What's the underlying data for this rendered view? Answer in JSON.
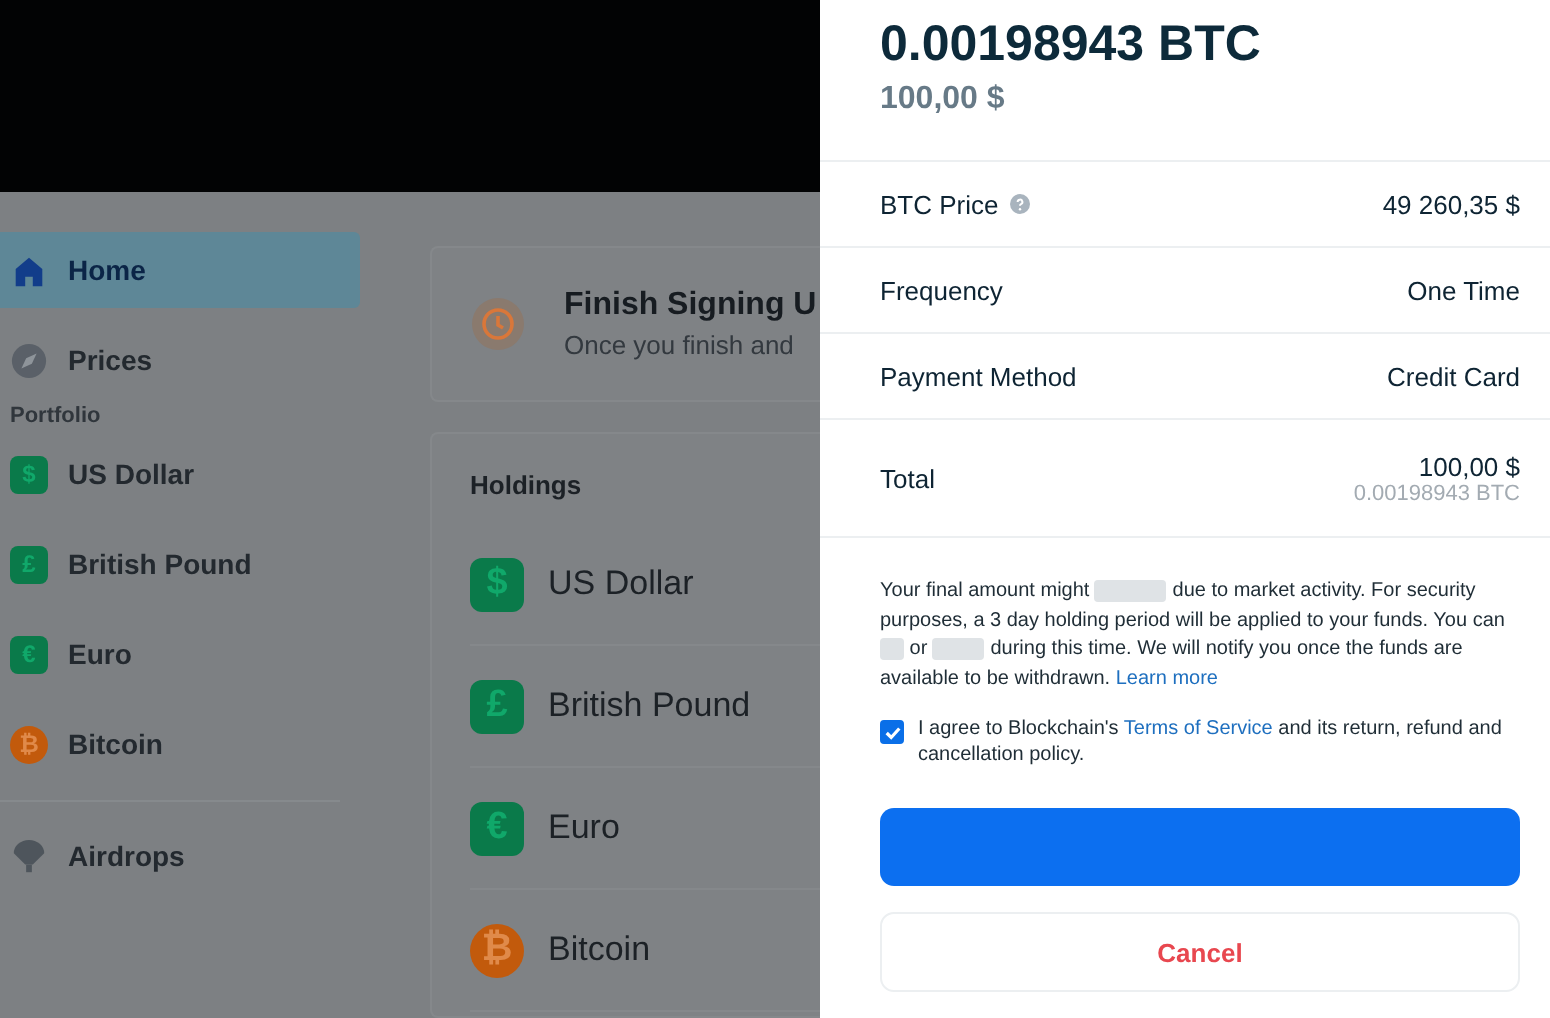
{
  "sidebar": {
    "sections": [
      {
        "items": [
          {
            "kind": "home",
            "label": "Home",
            "selected": true
          },
          {
            "kind": "compass",
            "label": "Prices",
            "selected": false
          }
        ]
      },
      {
        "heading": "Portfolio",
        "items": [
          {
            "kind": "asset",
            "label": "US Dollar",
            "symbol": "$",
            "color": "#0a7a4a",
            "selected": false
          },
          {
            "kind": "asset",
            "label": "British Pound",
            "symbol": "£",
            "color": "#0a7a4a",
            "selected": false
          },
          {
            "kind": "asset",
            "label": "Euro",
            "symbol": "€",
            "color": "#0a7a4a",
            "selected": false
          },
          {
            "kind": "asset",
            "label": "Bitcoin",
            "symbol": "₿",
            "color": "#c25a0c",
            "selected": false
          }
        ]
      },
      {
        "items": [
          {
            "kind": "airdrop",
            "label": "Airdrops",
            "selected": false
          }
        ]
      }
    ]
  },
  "signup_card": {
    "title": "Finish Signing U",
    "subtitle": "Once you finish and"
  },
  "holdings": {
    "title": "Holdings",
    "rows": [
      {
        "label": "US Dollar",
        "symbol": "$",
        "color": "#0a7a4a"
      },
      {
        "label": "British Pound",
        "symbol": "£",
        "color": "#0a7a4a"
      },
      {
        "label": "Euro",
        "symbol": "€",
        "color": "#0a7a4a"
      },
      {
        "label": "Bitcoin",
        "symbol": "₿",
        "color": "#c25a0c"
      }
    ]
  },
  "checkout": {
    "amount": "0.00198943 BTC",
    "fiat": "100,00 $",
    "rows": [
      {
        "label": "BTC Price",
        "value": "49 260,35 $",
        "info": true
      },
      {
        "label": "Frequency",
        "value": "One Time"
      },
      {
        "label": "Payment Method",
        "value": "Credit Card"
      },
      {
        "label": "Total",
        "value": "100,00 $",
        "secondary": "0.00198943 BTC"
      }
    ],
    "disclaimer": [
      {
        "kind": "text",
        "text": "Your final amount might "
      },
      {
        "kind": "redacted"
      },
      {
        "kind": "text",
        "text": " due to market activity. For security purposes, a 3 day holding period will be applied to your funds. You can "
      },
      {
        "kind": "redacted"
      },
      {
        "kind": "text",
        "text": " or "
      },
      {
        "kind": "redacted"
      },
      {
        "kind": "text",
        "text": " during this time. We will notify you once the funds are available to be withdrawn. "
      },
      {
        "kind": "link",
        "text": "Learn more"
      }
    ],
    "agreement": {
      "checked": true,
      "parts": [
        {
          "kind": "text",
          "text": "I agree to Blockchain's "
        },
        {
          "kind": "link",
          "text": "Terms of Service"
        },
        {
          "kind": "text",
          "text": " and its return, refund and cancellation policy."
        }
      ]
    },
    "cancel_button": "Cancel"
  }
}
